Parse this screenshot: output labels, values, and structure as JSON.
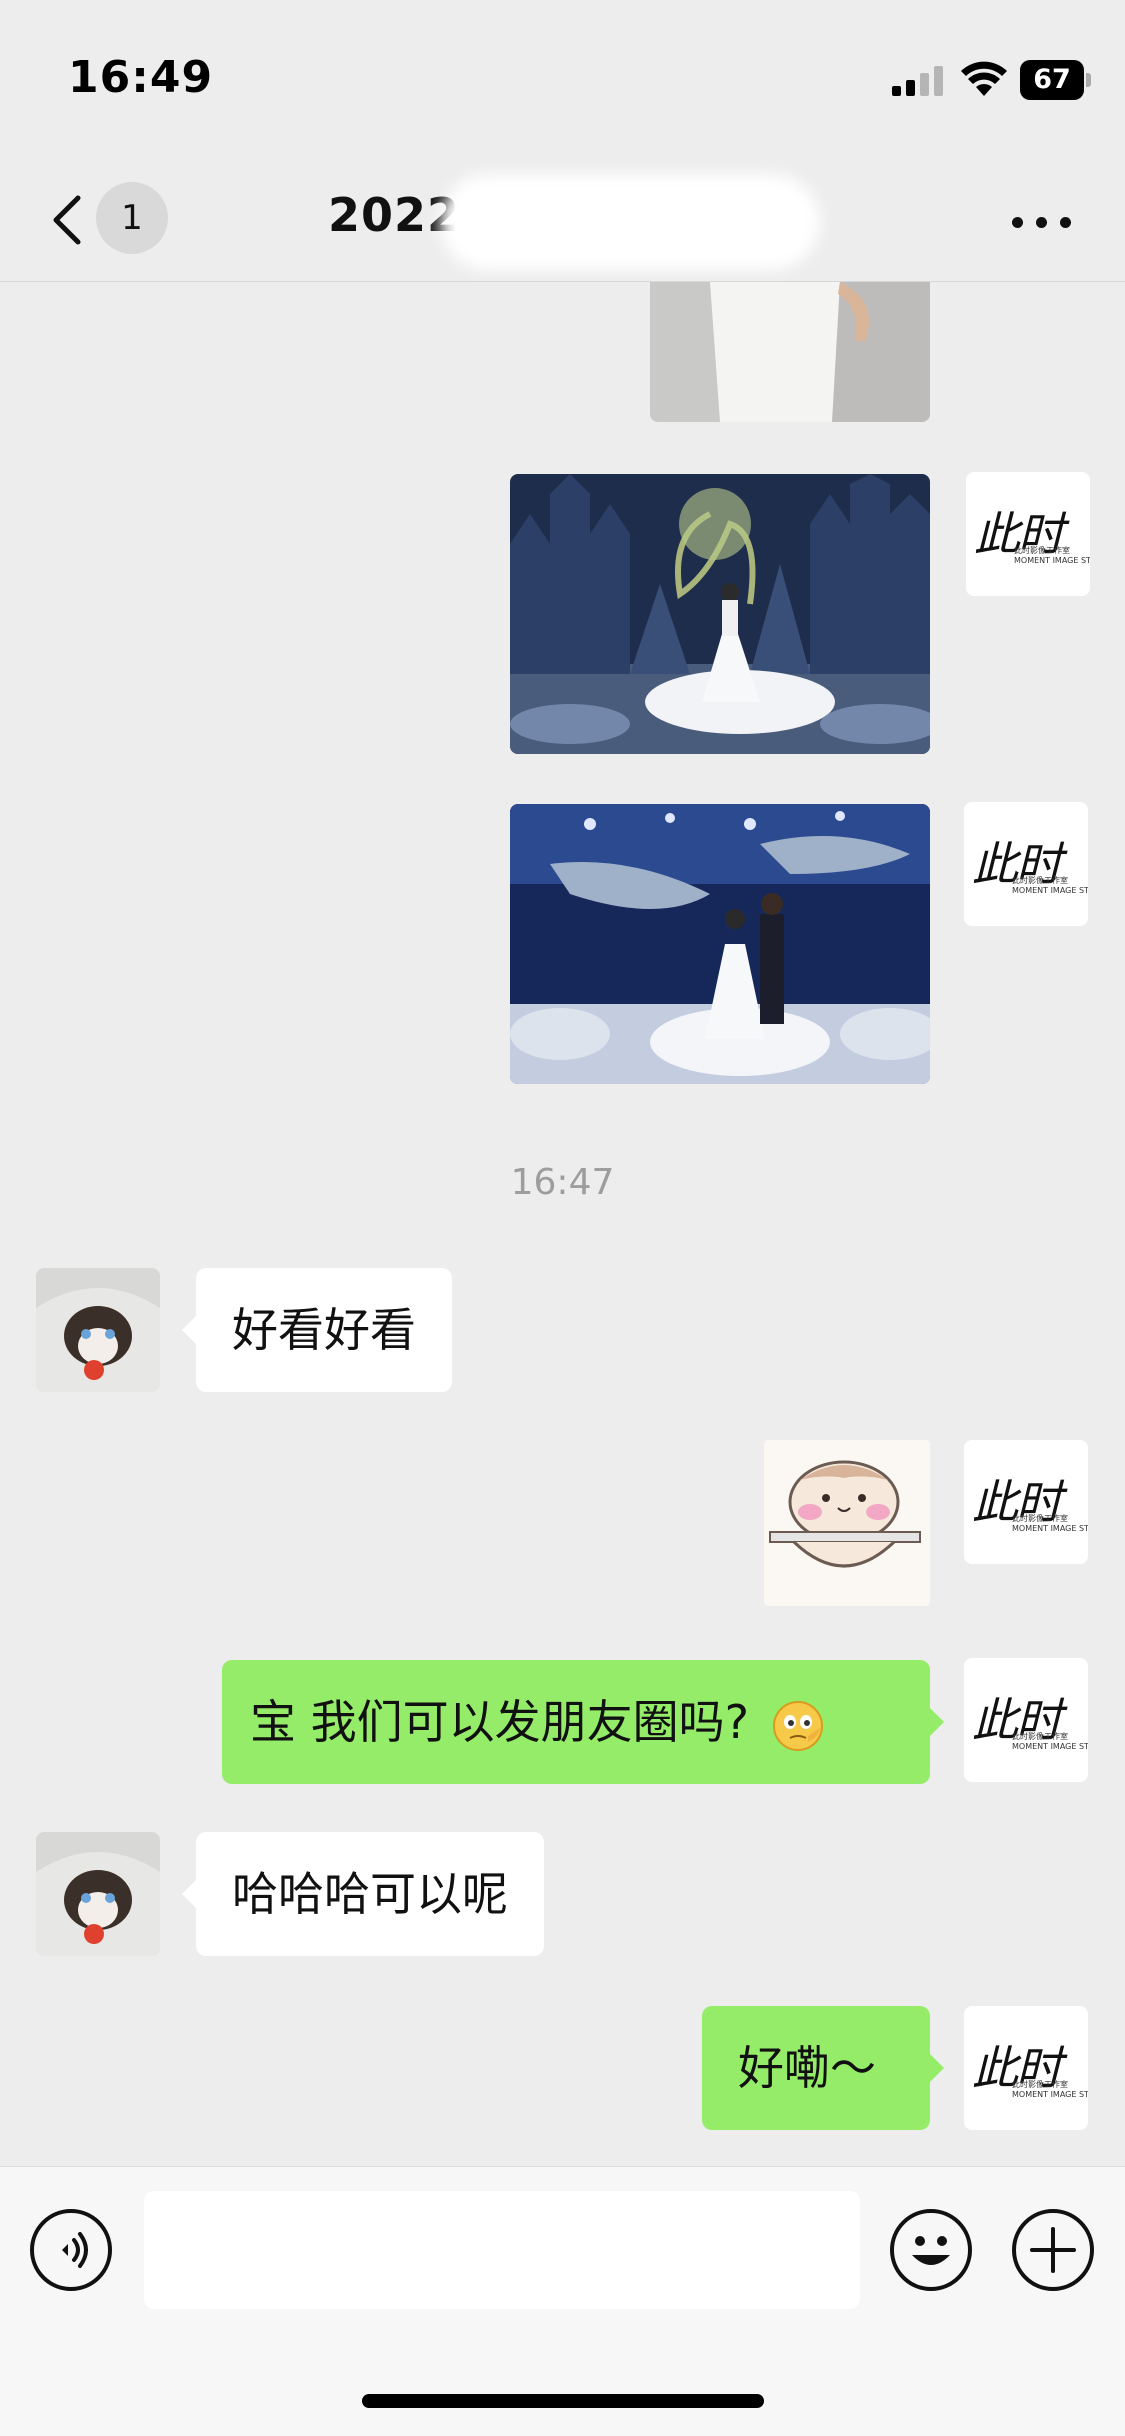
{
  "status_bar": {
    "time": "16:49",
    "battery": "67"
  },
  "nav": {
    "unread_count": "1",
    "title": "2022"
  },
  "timestamp": "16:47",
  "avatar_logo": {
    "mark": "此时",
    "subtitle_line1": "此时影像工作室",
    "subtitle_line2": "MOMENT IMAGE STUDIO"
  },
  "messages": [
    {
      "side": "in",
      "text": "好看好看"
    },
    {
      "side": "out",
      "text": "宝 我们可以发朋友圈吗?"
    },
    {
      "side": "in",
      "text": "哈哈哈可以呢"
    },
    {
      "side": "out",
      "text": "好嘞～"
    }
  ],
  "input": {
    "placeholder": ""
  },
  "colors": {
    "background": "#ededed",
    "outgoing_bubble": "#95ec69",
    "incoming_bubble": "#ffffff",
    "timestamp_text": "#9d9d9d"
  }
}
